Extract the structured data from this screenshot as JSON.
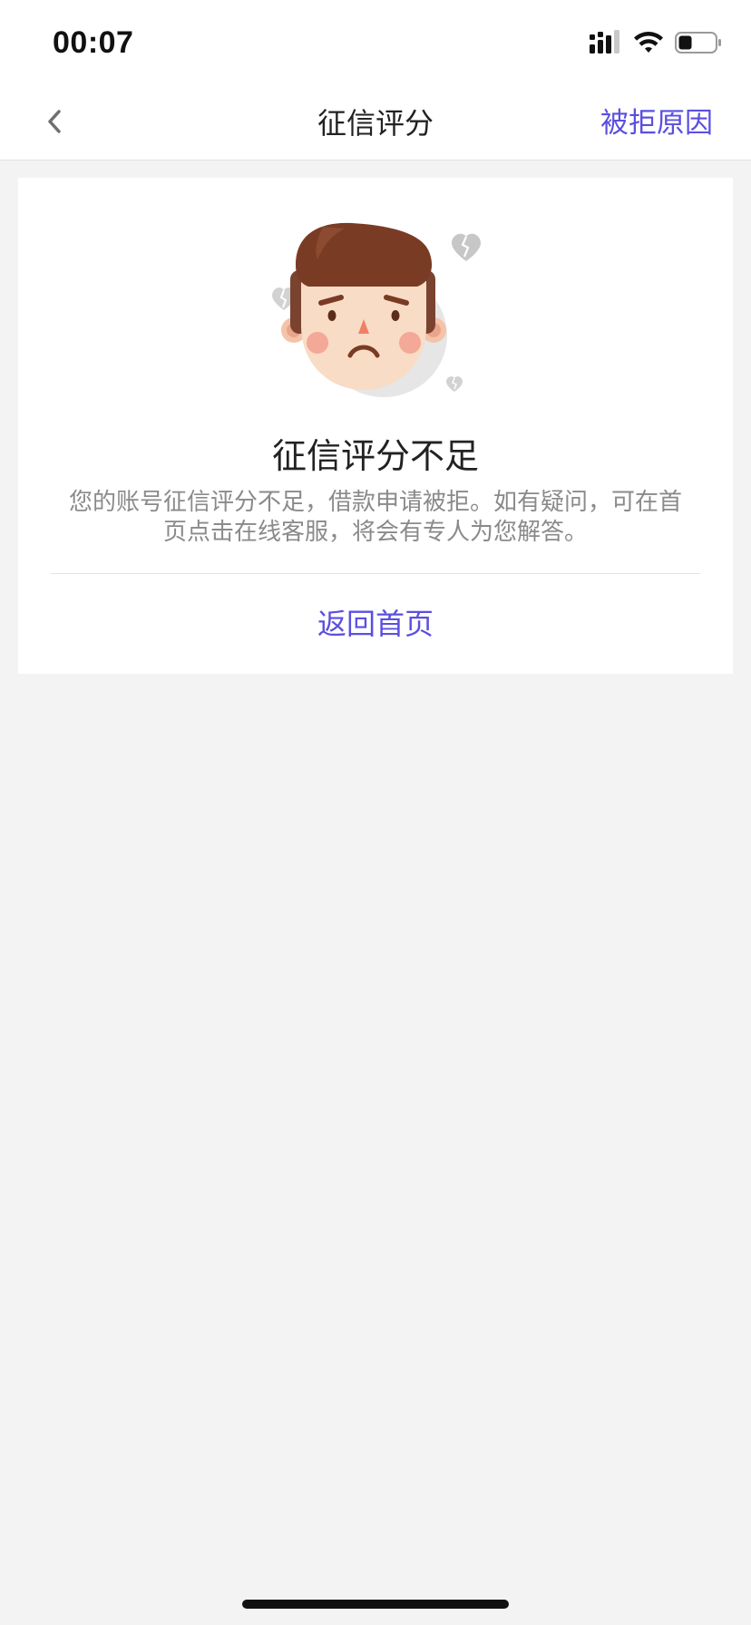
{
  "status_bar": {
    "time": "00:07",
    "icons": [
      "cellular-signal-icon",
      "wifi-icon",
      "battery-icon"
    ]
  },
  "nav": {
    "back_icon": "chevron-left-icon",
    "title": "征信评分",
    "action_label": "被拒原因"
  },
  "result": {
    "illustration": "sad-face-with-broken-hearts",
    "title": "征信评分不足",
    "description": "您的账号征信评分不足，借款申请被拒。如有疑问，可在首页点击在线客服，将会有专人为您解答。",
    "home_label": "返回首页"
  },
  "colors": {
    "accent": "#5b4fe0",
    "background": "#f3f3f3",
    "card": "#ffffff",
    "title_text": "#222222",
    "secondary_text": "#8a8a8a"
  }
}
